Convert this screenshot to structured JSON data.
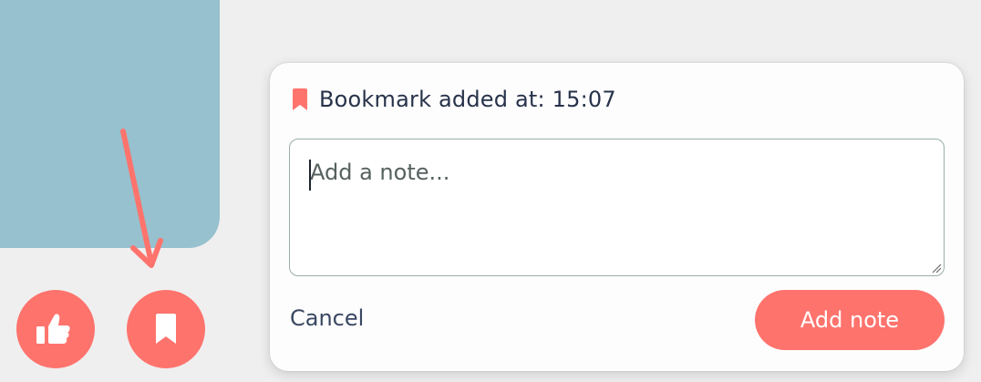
{
  "popup": {
    "title": "Bookmark added at: 15:07",
    "note_placeholder": "Add a note...",
    "note_value": "",
    "cancel_label": "Cancel",
    "add_note_label": "Add note"
  },
  "controls": {
    "like_icon": "thumbs-up-icon",
    "bookmark_icon": "bookmark-icon"
  },
  "colors": {
    "accent": "#ff736d",
    "video_panel": "#97c1ce",
    "text_dark": "#27324a",
    "background": "#efefef"
  }
}
